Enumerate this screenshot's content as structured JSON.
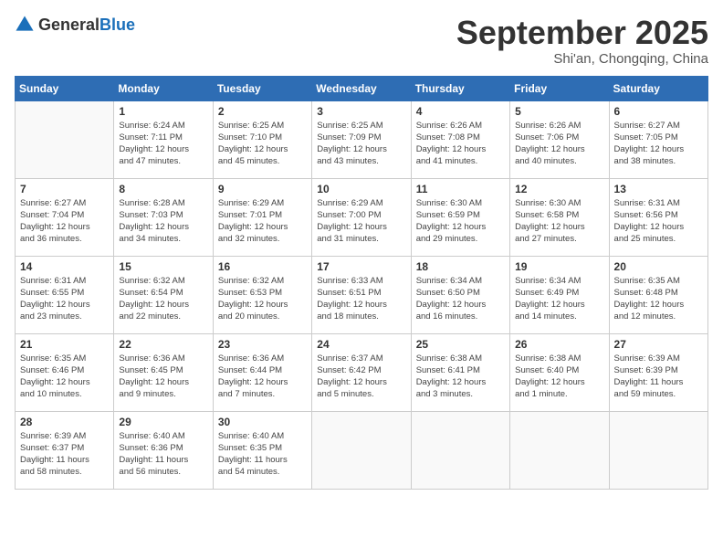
{
  "header": {
    "logo_general": "General",
    "logo_blue": "Blue",
    "month_title": "September 2025",
    "subtitle": "Shi'an, Chongqing, China"
  },
  "days_of_week": [
    "Sunday",
    "Monday",
    "Tuesday",
    "Wednesday",
    "Thursday",
    "Friday",
    "Saturday"
  ],
  "weeks": [
    [
      {
        "day": "",
        "info": ""
      },
      {
        "day": "1",
        "info": "Sunrise: 6:24 AM\nSunset: 7:11 PM\nDaylight: 12 hours\nand 47 minutes."
      },
      {
        "day": "2",
        "info": "Sunrise: 6:25 AM\nSunset: 7:10 PM\nDaylight: 12 hours\nand 45 minutes."
      },
      {
        "day": "3",
        "info": "Sunrise: 6:25 AM\nSunset: 7:09 PM\nDaylight: 12 hours\nand 43 minutes."
      },
      {
        "day": "4",
        "info": "Sunrise: 6:26 AM\nSunset: 7:08 PM\nDaylight: 12 hours\nand 41 minutes."
      },
      {
        "day": "5",
        "info": "Sunrise: 6:26 AM\nSunset: 7:06 PM\nDaylight: 12 hours\nand 40 minutes."
      },
      {
        "day": "6",
        "info": "Sunrise: 6:27 AM\nSunset: 7:05 PM\nDaylight: 12 hours\nand 38 minutes."
      }
    ],
    [
      {
        "day": "7",
        "info": "Sunrise: 6:27 AM\nSunset: 7:04 PM\nDaylight: 12 hours\nand 36 minutes."
      },
      {
        "day": "8",
        "info": "Sunrise: 6:28 AM\nSunset: 7:03 PM\nDaylight: 12 hours\nand 34 minutes."
      },
      {
        "day": "9",
        "info": "Sunrise: 6:29 AM\nSunset: 7:01 PM\nDaylight: 12 hours\nand 32 minutes."
      },
      {
        "day": "10",
        "info": "Sunrise: 6:29 AM\nSunset: 7:00 PM\nDaylight: 12 hours\nand 31 minutes."
      },
      {
        "day": "11",
        "info": "Sunrise: 6:30 AM\nSunset: 6:59 PM\nDaylight: 12 hours\nand 29 minutes."
      },
      {
        "day": "12",
        "info": "Sunrise: 6:30 AM\nSunset: 6:58 PM\nDaylight: 12 hours\nand 27 minutes."
      },
      {
        "day": "13",
        "info": "Sunrise: 6:31 AM\nSunset: 6:56 PM\nDaylight: 12 hours\nand 25 minutes."
      }
    ],
    [
      {
        "day": "14",
        "info": "Sunrise: 6:31 AM\nSunset: 6:55 PM\nDaylight: 12 hours\nand 23 minutes."
      },
      {
        "day": "15",
        "info": "Sunrise: 6:32 AM\nSunset: 6:54 PM\nDaylight: 12 hours\nand 22 minutes."
      },
      {
        "day": "16",
        "info": "Sunrise: 6:32 AM\nSunset: 6:53 PM\nDaylight: 12 hours\nand 20 minutes."
      },
      {
        "day": "17",
        "info": "Sunrise: 6:33 AM\nSunset: 6:51 PM\nDaylight: 12 hours\nand 18 minutes."
      },
      {
        "day": "18",
        "info": "Sunrise: 6:34 AM\nSunset: 6:50 PM\nDaylight: 12 hours\nand 16 minutes."
      },
      {
        "day": "19",
        "info": "Sunrise: 6:34 AM\nSunset: 6:49 PM\nDaylight: 12 hours\nand 14 minutes."
      },
      {
        "day": "20",
        "info": "Sunrise: 6:35 AM\nSunset: 6:48 PM\nDaylight: 12 hours\nand 12 minutes."
      }
    ],
    [
      {
        "day": "21",
        "info": "Sunrise: 6:35 AM\nSunset: 6:46 PM\nDaylight: 12 hours\nand 10 minutes."
      },
      {
        "day": "22",
        "info": "Sunrise: 6:36 AM\nSunset: 6:45 PM\nDaylight: 12 hours\nand 9 minutes."
      },
      {
        "day": "23",
        "info": "Sunrise: 6:36 AM\nSunset: 6:44 PM\nDaylight: 12 hours\nand 7 minutes."
      },
      {
        "day": "24",
        "info": "Sunrise: 6:37 AM\nSunset: 6:42 PM\nDaylight: 12 hours\nand 5 minutes."
      },
      {
        "day": "25",
        "info": "Sunrise: 6:38 AM\nSunset: 6:41 PM\nDaylight: 12 hours\nand 3 minutes."
      },
      {
        "day": "26",
        "info": "Sunrise: 6:38 AM\nSunset: 6:40 PM\nDaylight: 12 hours\nand 1 minute."
      },
      {
        "day": "27",
        "info": "Sunrise: 6:39 AM\nSunset: 6:39 PM\nDaylight: 11 hours\nand 59 minutes."
      }
    ],
    [
      {
        "day": "28",
        "info": "Sunrise: 6:39 AM\nSunset: 6:37 PM\nDaylight: 11 hours\nand 58 minutes."
      },
      {
        "day": "29",
        "info": "Sunrise: 6:40 AM\nSunset: 6:36 PM\nDaylight: 11 hours\nand 56 minutes."
      },
      {
        "day": "30",
        "info": "Sunrise: 6:40 AM\nSunset: 6:35 PM\nDaylight: 11 hours\nand 54 minutes."
      },
      {
        "day": "",
        "info": ""
      },
      {
        "day": "",
        "info": ""
      },
      {
        "day": "",
        "info": ""
      },
      {
        "day": "",
        "info": ""
      }
    ]
  ]
}
